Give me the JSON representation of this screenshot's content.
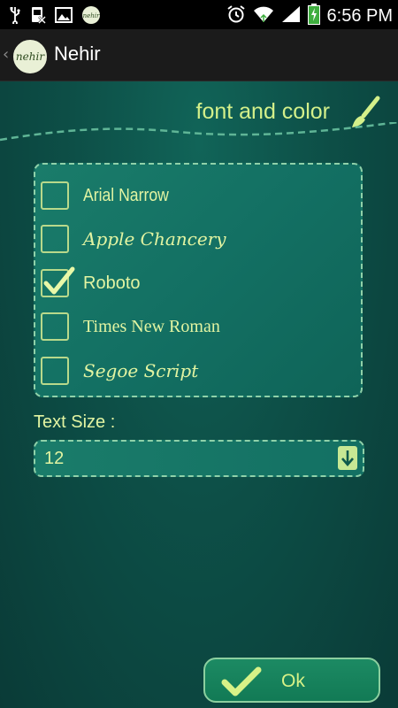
{
  "status_bar": {
    "left_icons": [
      "usb-icon",
      "sim-icon",
      "gallery-icon",
      "nehir-notification-icon"
    ],
    "right_icons": [
      "alarm-icon",
      "wifi-icon",
      "signal-icon",
      "battery-charging-icon"
    ],
    "time": "6:56 PM"
  },
  "action_bar": {
    "logo_text": "nehir",
    "title": "Nehir"
  },
  "section": {
    "title": "font and color",
    "icon": "paintbrush-icon"
  },
  "fonts": [
    {
      "label": "Arial Narrow",
      "checked": false
    },
    {
      "label": "Apple Chancery",
      "checked": false
    },
    {
      "label": "Roboto",
      "checked": true
    },
    {
      "label": "Times New Roman",
      "checked": false
    },
    {
      "label": "Segoe Script",
      "checked": false
    }
  ],
  "text_size": {
    "label": "Text Size :",
    "value": "12"
  },
  "ok_button": {
    "label": "Ok"
  },
  "colors": {
    "accent_text": "#e2f4a2",
    "background": "#0d4f47",
    "dashed_border": "#8fd1a9"
  }
}
